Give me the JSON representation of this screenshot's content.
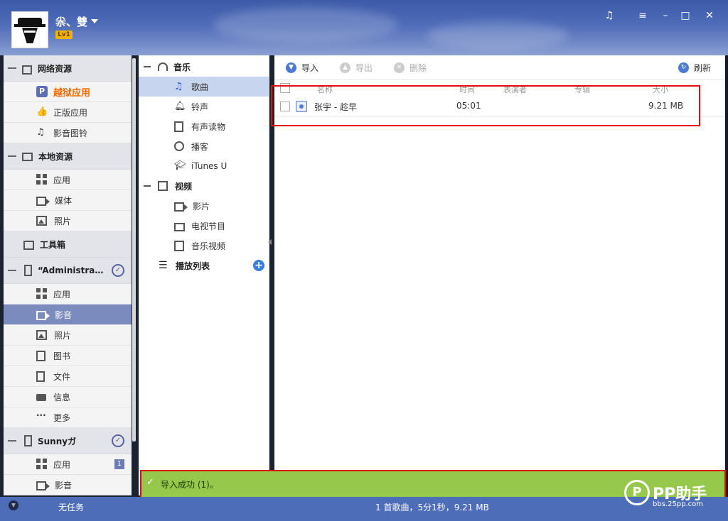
{
  "header": {
    "username": "尜、雙",
    "level": "Lv1",
    "window_controls": [
      "music-icon",
      "menu-icon",
      "minimize-icon",
      "maximize-icon",
      "close-icon"
    ]
  },
  "sidebar": {
    "sections": [
      {
        "title": "网络资源",
        "items": [
          "越狱应用",
          "正版应用",
          "影音图铃"
        ]
      },
      {
        "title": "本地资源",
        "items": [
          "应用",
          "媒体",
          "照片"
        ]
      },
      {
        "title": "工具箱",
        "items": []
      },
      {
        "title": "“Administra…",
        "items": [
          "应用",
          "影音",
          "照片",
          "图书",
          "文件",
          "信息",
          "更多"
        ]
      },
      {
        "title": "Sunnyガ",
        "items": [
          "应用",
          "影音",
          "照片"
        ],
        "badge": "1"
      }
    ],
    "active_item": "影音",
    "highlighted_item": "越狱应用"
  },
  "mid_nav": {
    "music_title": "音乐",
    "music_items": [
      "歌曲",
      "铃声",
      "有声读物",
      "播客",
      "iTunes U"
    ],
    "video_title": "视频",
    "video_items": [
      "影片",
      "电视节目",
      "音乐视频"
    ],
    "playlist_title": "播放列表",
    "active_item": "歌曲"
  },
  "toolbar": {
    "import": "导入",
    "export": "导出",
    "delete": "删除",
    "refresh": "刷新"
  },
  "table": {
    "columns": [
      "名称",
      "时间",
      "表演者",
      "专辑",
      "大小"
    ],
    "rows": [
      {
        "name": "张宇 - 趁早",
        "time": "05:01",
        "artist": "",
        "album": "",
        "size": "9.21 MB"
      }
    ]
  },
  "status": {
    "message": "导入成功 (1)。"
  },
  "bottom": {
    "tasks": "无任务",
    "summary": "1 首歌曲，5分1秒，9.21 MB"
  },
  "watermark": {
    "brand": "PP助手",
    "url": "bbs.25pp.com"
  }
}
